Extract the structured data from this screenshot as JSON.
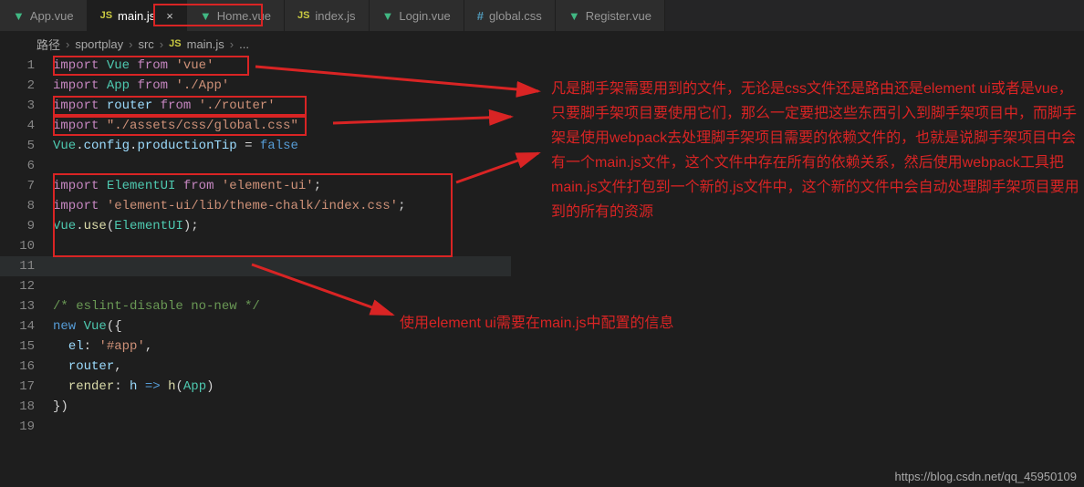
{
  "tabs": [
    {
      "icon": "vue",
      "label": "App.vue",
      "active": false
    },
    {
      "icon": "js",
      "label": "main.js",
      "active": true,
      "closable": true
    },
    {
      "icon": "vue",
      "label": "Home.vue",
      "active": false
    },
    {
      "icon": "js",
      "label": "index.js",
      "active": false
    },
    {
      "icon": "vue",
      "label": "Login.vue",
      "active": false
    },
    {
      "icon": "css",
      "label": "global.css",
      "active": false
    },
    {
      "icon": "vue",
      "label": "Register.vue",
      "active": false
    }
  ],
  "breadcrumb": {
    "label": "路径",
    "parts": [
      "sportplay",
      "src",
      "main.js",
      "..."
    ],
    "file_icon": "js"
  },
  "code": {
    "lines": [
      "import Vue from 'vue'",
      "import App from './App'",
      "import router from './router'",
      "import \"./assets/css/global.css\"",
      "Vue.config.productionTip = false",
      "",
      "import ElementUI from 'element-ui';",
      "import 'element-ui/lib/theme-chalk/index.css';",
      "Vue.use(ElementUI);",
      "",
      "",
      "",
      "/* eslint-disable no-new */",
      "new Vue({",
      "  el: '#app',",
      "  router,",
      "  render: h => h(App)",
      "})",
      ""
    ],
    "line_count": 19
  },
  "annotations": {
    "main": "凡是脚手架需要用到的文件，无论是css文件还是路由还是element ui或者是vue，只要脚手架项目要使用它们，那么一定要把这些东西引入到脚手架项目中，而脚手架是使用webpack去处理脚手架项目需要的依赖文件的，也就是说脚手架项目中会有一个main.js文件，这个文件中存在所有的依赖关系，然后使用webpack工具把main.js文件打包到一个新的.js文件中，这个新的文件中会自动处理脚手架项目要用到的所有的资源",
    "second": "使用element ui需要在main.js中配置的信息"
  },
  "watermark": "https://blog.csdn.net/qq_45950109",
  "colors": {
    "annotation": "#d92424",
    "bg": "#1e1e1e",
    "keyword": "#c586c0",
    "string": "#ce9178",
    "variable": "#9cdcfe",
    "class": "#4ec9b0",
    "const": "#569cd6",
    "comment": "#6a9955"
  }
}
